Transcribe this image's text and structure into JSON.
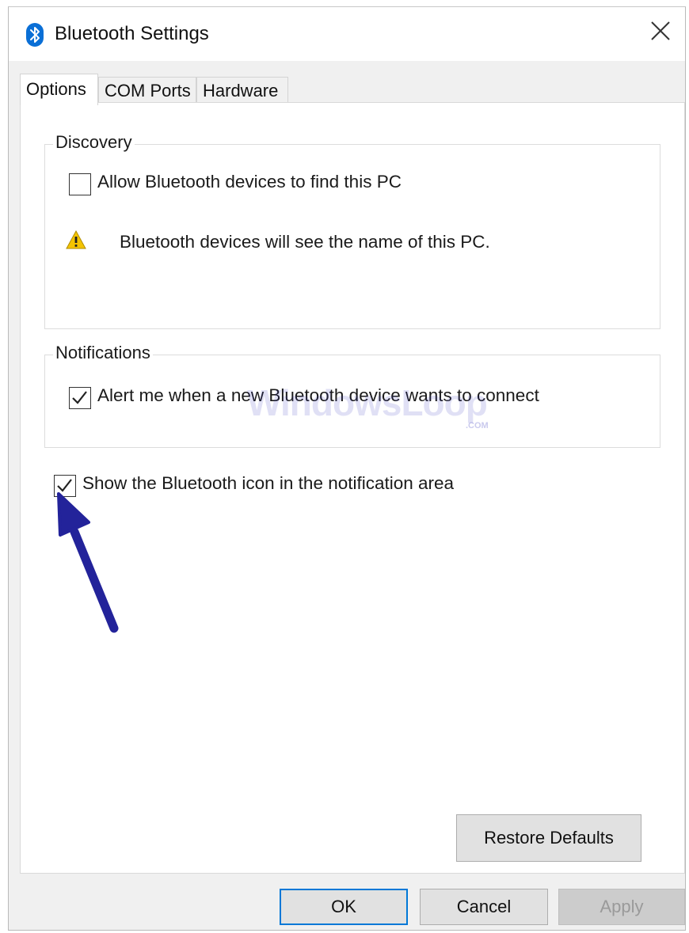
{
  "window": {
    "title": "Bluetooth Settings",
    "icon": "bluetooth-icon",
    "close_icon": "close-icon"
  },
  "tabs": [
    {
      "label": "Options",
      "active": true
    },
    {
      "label": "COM Ports",
      "active": false
    },
    {
      "label": "Hardware",
      "active": false
    }
  ],
  "discovery": {
    "group_label": "Discovery",
    "allow_label": "Allow Bluetooth devices to find this PC",
    "allow_checked": false,
    "warning_icon": "warning-icon",
    "warning_text": "Bluetooth devices will see the name of this PC."
  },
  "notifications": {
    "group_label": "Notifications",
    "alert_label": "Alert me when a new Bluetooth device wants to connect",
    "alert_checked": true
  },
  "show_icon": {
    "label": "Show the Bluetooth icon in the notification area",
    "checked": true
  },
  "watermark": {
    "text": "WindowsLoop",
    "sub": ".COM"
  },
  "annotation": {
    "arrow_color": "#23239a"
  },
  "buttons": {
    "restore_defaults": "Restore Defaults",
    "ok": "OK",
    "cancel": "Cancel",
    "apply": "Apply",
    "apply_disabled": true
  },
  "colors": {
    "bluetooth_blue": "#0a6fd6",
    "warning_yellow": "#f4c400",
    "default_button_border": "#0078d7"
  }
}
